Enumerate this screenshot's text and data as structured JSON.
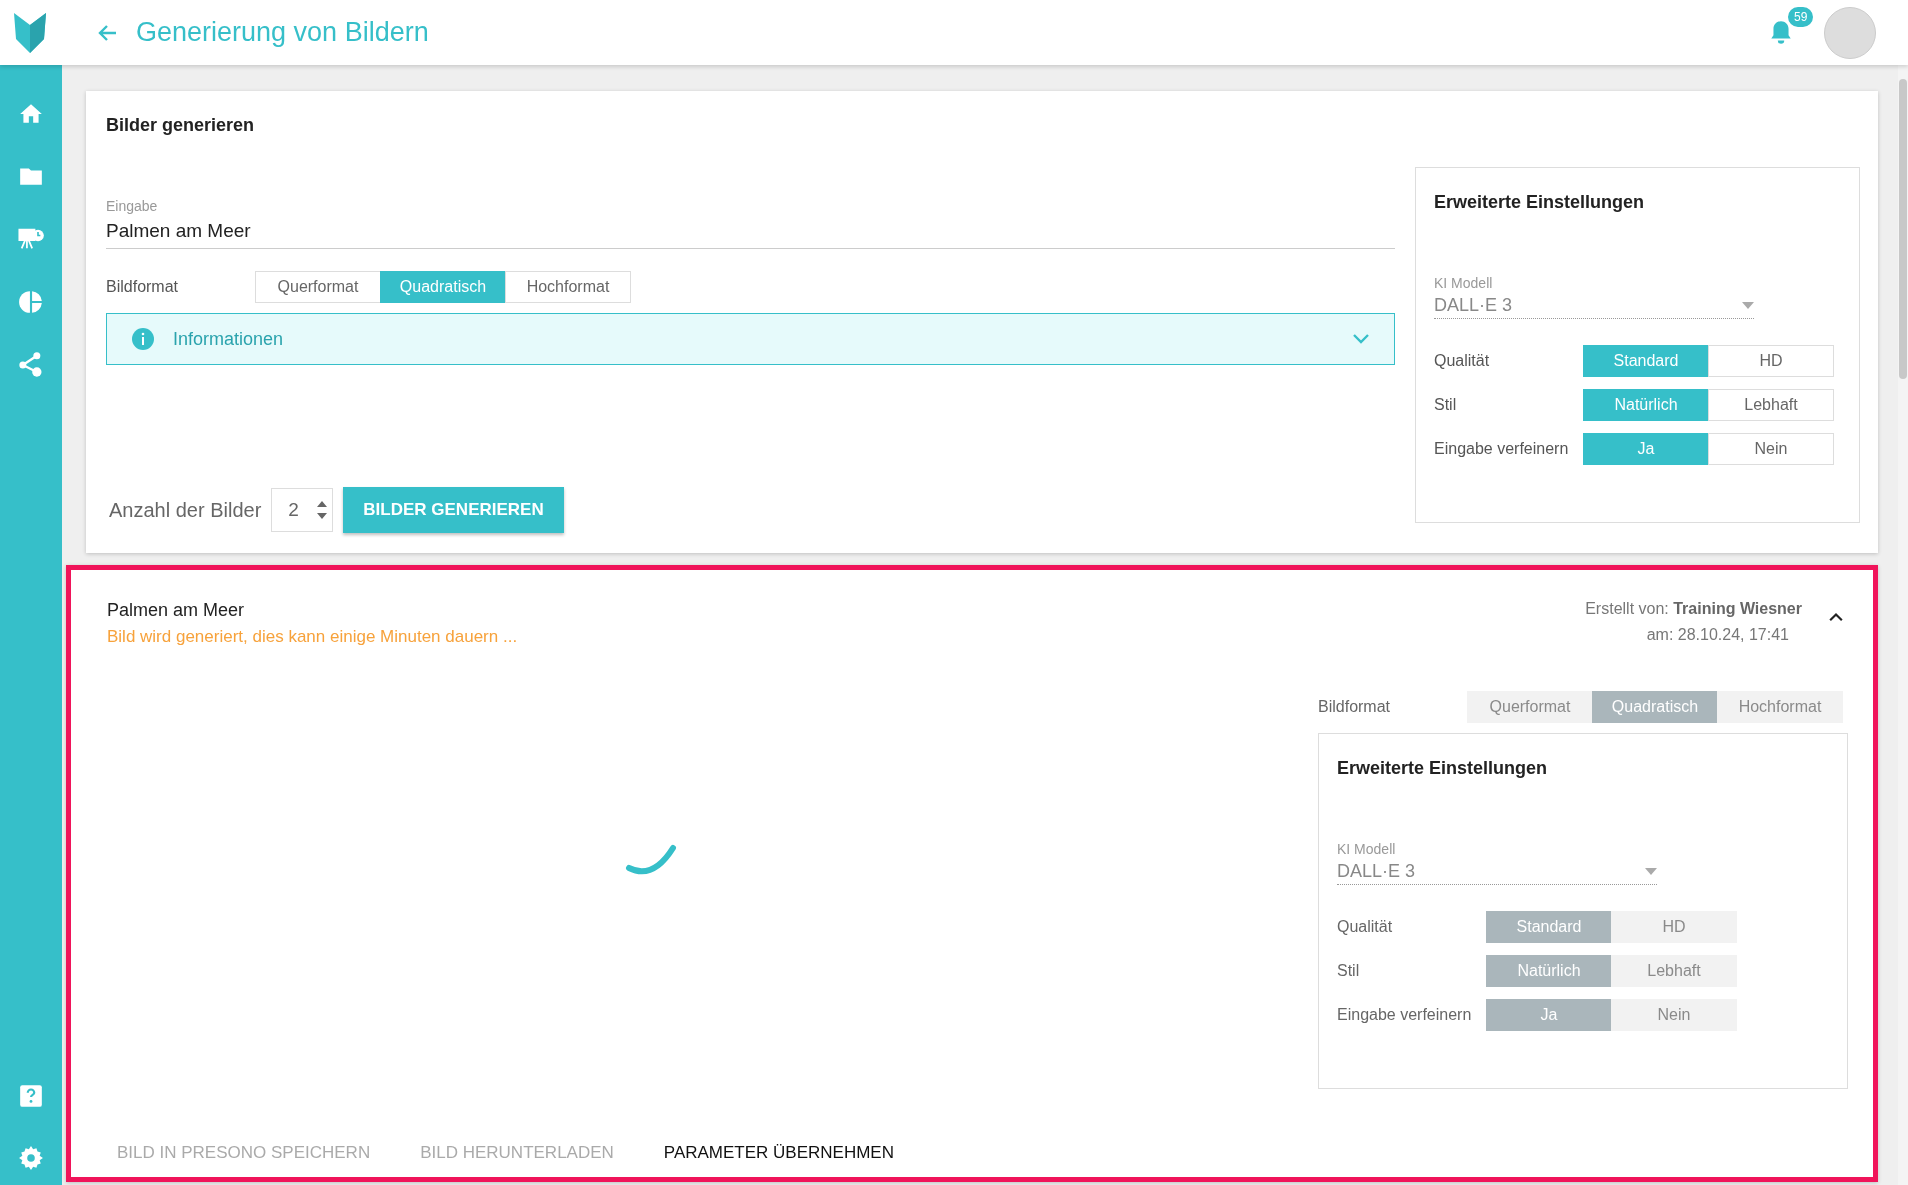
{
  "header": {
    "title": "Generierung von Bildern",
    "notification_count": "59"
  },
  "generator": {
    "title": "Bilder generieren",
    "prompt": {
      "label": "Eingabe",
      "value": "Palmen am Meer"
    },
    "format": {
      "label": "Bildformat",
      "options": [
        {
          "label": "Querformat",
          "selected": false
        },
        {
          "label": "Quadratisch",
          "selected": true
        },
        {
          "label": "Hochformat",
          "selected": false
        }
      ]
    },
    "info": {
      "label": "Informationen",
      "expanded": false
    },
    "count": {
      "label": "Anzahl der Bilder",
      "value": "2"
    },
    "generate_button": "BILDER GENERIEREN",
    "advanced": {
      "title": "Erweiterte Einstellungen",
      "model": {
        "label": "KI Modell",
        "value": "DALL·E 3",
        "disabled": true
      },
      "settings": [
        {
          "label": "Qualität",
          "options": [
            {
              "label": "Standard",
              "selected": true
            },
            {
              "label": "HD",
              "selected": false
            }
          ]
        },
        {
          "label": "Stil",
          "options": [
            {
              "label": "Natürlich",
              "selected": true
            },
            {
              "label": "Lebhaft",
              "selected": false
            }
          ]
        },
        {
          "label": "Eingabe verfeinern",
          "options": [
            {
              "label": "Ja",
              "selected": true
            },
            {
              "label": "Nein",
              "selected": false
            }
          ]
        }
      ]
    }
  },
  "result": {
    "highlighted": true,
    "title": "Palmen am Meer",
    "status": "Bild wird generiert, dies kann einige Minuten dauern ...",
    "created_by_label": "Erstellt von:",
    "created_by": "Training Wiesner",
    "date": "am: 28.10.24, 17:41",
    "expanded": true,
    "loading": true,
    "disabled": true,
    "format": {
      "label": "Bildformat",
      "options": [
        {
          "label": "Querformat",
          "selected": false
        },
        {
          "label": "Quadratisch",
          "selected": true
        },
        {
          "label": "Hochformat",
          "selected": false
        }
      ]
    },
    "advanced": {
      "title": "Erweiterte Einstellungen",
      "model": {
        "label": "KI Modell",
        "value": "DALL·E 3",
        "disabled": true
      },
      "settings": [
        {
          "label": "Qualität",
          "options": [
            {
              "label": "Standard",
              "selected": true
            },
            {
              "label": "HD",
              "selected": false
            }
          ]
        },
        {
          "label": "Stil",
          "options": [
            {
              "label": "Natürlich",
              "selected": true
            },
            {
              "label": "Lebhaft",
              "selected": false
            }
          ]
        },
        {
          "label": "Eingabe verfeinern",
          "options": [
            {
              "label": "Ja",
              "selected": true
            },
            {
              "label": "Nein",
              "selected": false
            }
          ]
        }
      ]
    },
    "actions": [
      {
        "label": "BILD IN PRESONO SPEICHERN",
        "disabled": true
      },
      {
        "label": "BILD HERUNTERLADEN",
        "disabled": true
      },
      {
        "label": "PARAMETER ÜBERNEHMEN",
        "disabled": false
      }
    ]
  }
}
